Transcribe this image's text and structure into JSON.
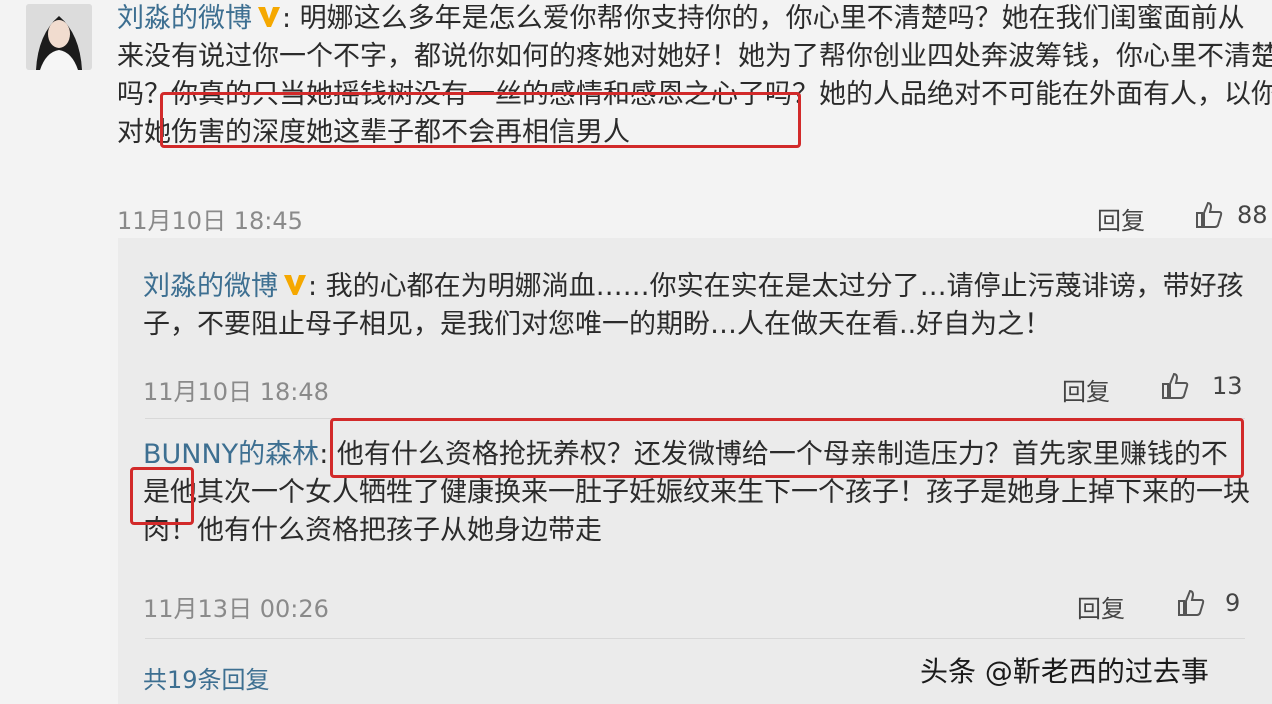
{
  "comment1": {
    "author": "刘淼的微博",
    "lines": [
      ": 明娜这么多年是怎么爱你帮你支持你的，你心里不清楚吗？她在我们闺蜜面前从",
      "来没有说过你一个不字，都说你如何的疼她对她好！她为了帮你创业四处奔波筹钱，你心里不清楚",
      "吗？你真的只当她摇钱树没有一丝的感情和感恩之心了吗？她的人品绝对不可能在外面有人，以你",
      "对她伤害的深度她这辈子都不会再相信男人"
    ],
    "time": "11月10日 18:45",
    "reply_label": "回复",
    "likes": "88"
  },
  "reply1": {
    "author": "刘淼的微博",
    "lines": [
      ": 我的心都在为明娜淌血……你实在实在是太过分了…请停止污蔑诽谤，带好孩",
      "子，不要阻止母子相见，是我们对您唯一的期盼…人在做天在看..好自为之！"
    ],
    "time": "11月10日 18:48",
    "reply_label": "回复",
    "likes": "13"
  },
  "reply2": {
    "author": "BUNNY的森林",
    "lines": [
      ": 他有什么资格抢抚养权？还发微博给一个母亲制造压力？首先家里赚钱的不",
      "是他其次一个女人牺牲了健康换来一肚子妊娠纹来生下一个孩子！孩子是她身上掉下来的一块",
      "肉！他有什么资格把孩子从她身边带走"
    ],
    "time": "11月13日 00:26",
    "reply_label": "回复",
    "likes": "9"
  },
  "more_replies": "共19条回复",
  "watermark": "头条 @靳老西的过去事",
  "colors": {
    "author": "#3d6f91",
    "highlight": "#d22a2a",
    "verified": "#f5a800"
  }
}
